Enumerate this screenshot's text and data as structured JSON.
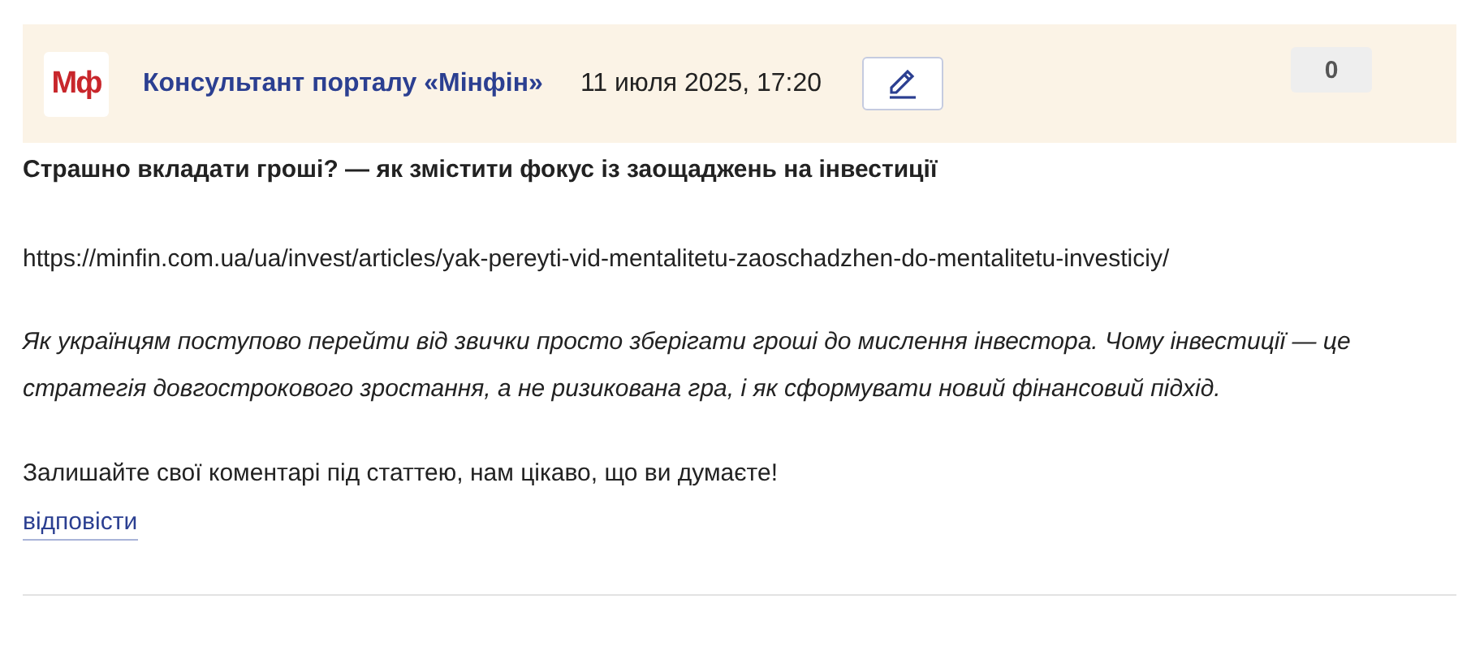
{
  "comment": {
    "logo": "Мф",
    "author": "Консультант порталу «Мінфін»",
    "date": "11 июля 2025, 17:20",
    "votes": "0",
    "title": "Страшно вкладати гроші? — як змістити фокус із заощаджень на інвестиції",
    "url": "https://minfin.com.ua/ua/invest/articles/yak-pereyti-vid-mentalitetu-zaoschadzhen-do-mentalitetu-investiciy/",
    "summary": "Як українцям поступово перейти від звички просто зберігати гроші до мислення інвестора. Чому інвестиції — це стратегія довгострокового зростання, а не ризикована гра, і як сформувати новий фінансовий підхід.",
    "call": "Залишайте свої коментарі під статтею, нам цікаво, що ви думаєте!",
    "reply": "відповісти"
  }
}
